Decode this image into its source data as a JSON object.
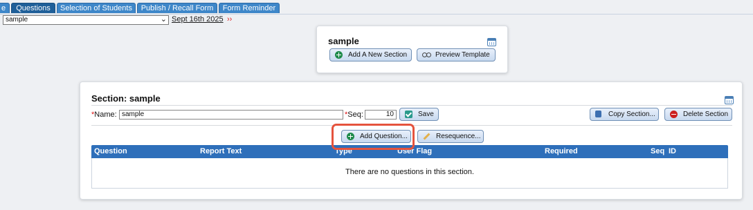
{
  "tabs": [
    {
      "label": "e",
      "active": false
    },
    {
      "label": "Questions",
      "active": true
    },
    {
      "label": "Selection of Students",
      "active": false
    },
    {
      "label": "Publish / Recall Form",
      "active": false
    },
    {
      "label": "Form Reminder",
      "active": false
    }
  ],
  "form_selector": {
    "cut_label": ":",
    "selected": "sample",
    "date": "Sept 16th 2025",
    "next_marker": "››"
  },
  "template": {
    "title": "sample",
    "add_section_label": "Add A New Section",
    "preview_label": "Preview Template"
  },
  "section": {
    "title": "Section: sample",
    "name_label": "Name:",
    "name_value": "sample",
    "seq_label": "Seq:",
    "seq_value": "10",
    "save_label": "Save",
    "copy_label": "Copy Section...",
    "delete_label": "Delete Section",
    "add_question_label": "Add Question...",
    "resequence_label": "Resequence...",
    "required_marker": "*"
  },
  "questions_table": {
    "columns": [
      "Question",
      "Report Text",
      "Type",
      "User Flag",
      "Required",
      "Seq",
      "ID"
    ],
    "empty_message": "There are no questions in this section."
  },
  "colors": {
    "tab_blue": "#3e87c9",
    "table_header": "#2e6fba",
    "highlight": "#e5533d",
    "required": "#dd1111"
  },
  "icons": [
    "calendar-icon",
    "add-icon",
    "binoculars-icon",
    "save-check-icon",
    "copy-icon",
    "delete-icon",
    "pencil-icon"
  ]
}
